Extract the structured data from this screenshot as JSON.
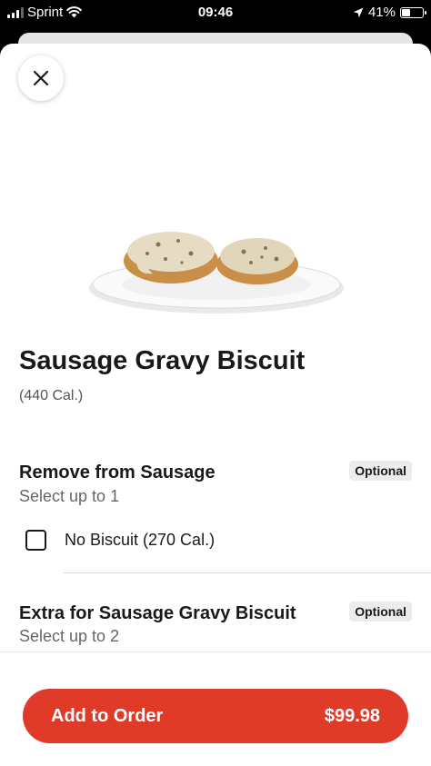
{
  "status_bar": {
    "carrier": "Sprint",
    "time": "09:46",
    "battery_percent": "41%",
    "battery_level": 0.41,
    "icons": [
      "signal-icon",
      "wifi-icon",
      "location-arrow-icon",
      "battery-icon"
    ]
  },
  "item": {
    "title": "Sausage Gravy Biscuit",
    "calories": "(440 Cal.)",
    "image_icon": "sausage-gravy-biscuit-photo"
  },
  "groups": [
    {
      "title": "Remove from Sausage",
      "subtitle": "Select up to 1",
      "badge": "Optional",
      "options": [
        {
          "label": "No Biscuit (270 Cal.)",
          "checked": false
        }
      ]
    },
    {
      "title": "Extra for Sausage Gravy Biscuit",
      "subtitle": "Select up to 2",
      "badge": "Optional"
    }
  ],
  "footer": {
    "add_label": "Add to Order",
    "price": "$99.98"
  },
  "colors": {
    "accent": "#e03a29",
    "badge_bg": "#ececec",
    "text": "#191919"
  }
}
